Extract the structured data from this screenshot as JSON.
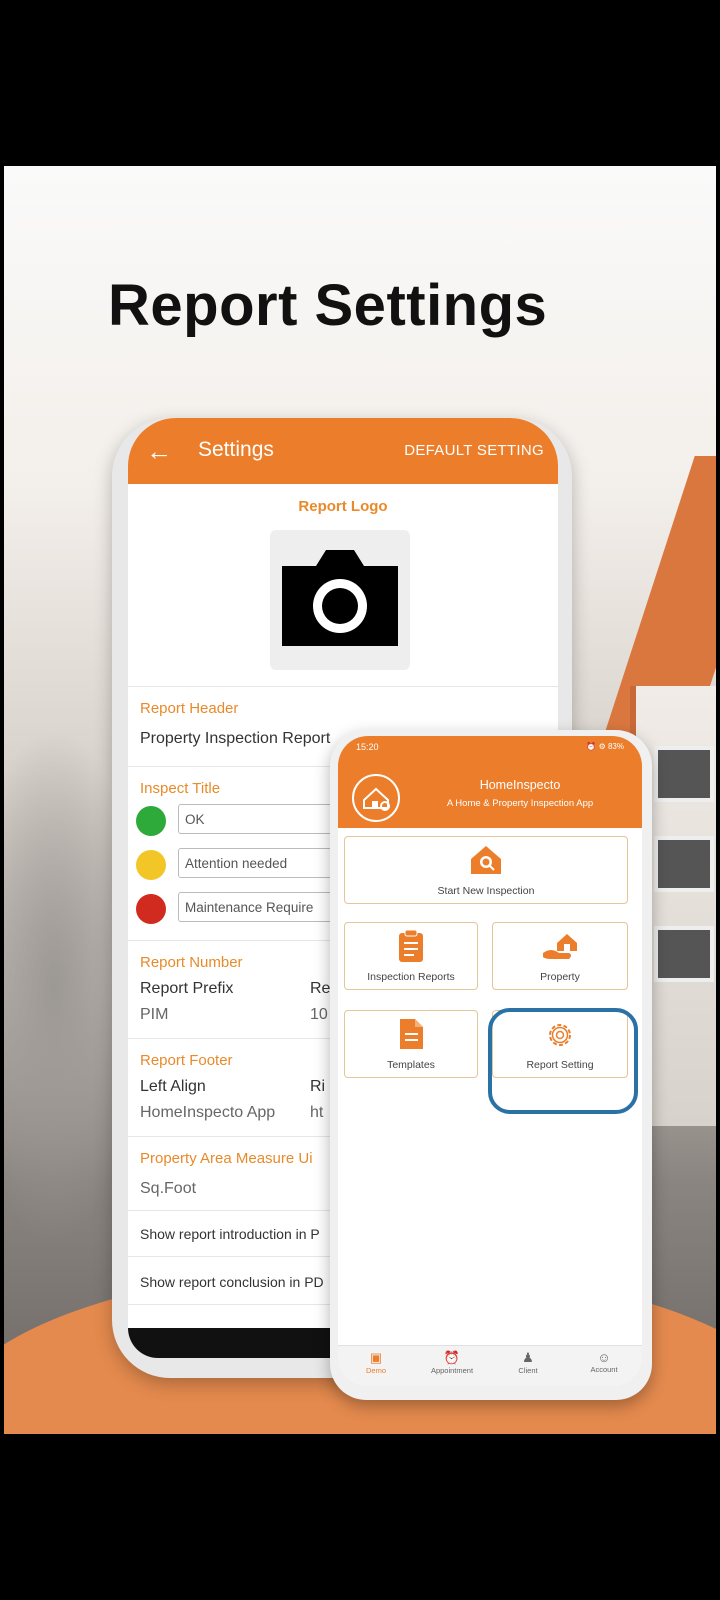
{
  "page": {
    "heading": "Report Settings",
    "colors": {
      "accent": "#ec7e2b",
      "highlight_ring": "#2a72a6",
      "ok": "#2eaa3a",
      "attention": "#f2c626",
      "maintenance": "#d12a1e"
    }
  },
  "settings_screen": {
    "back_icon": "arrow-left-icon",
    "title": "Settings",
    "default_setting": "DEFAULT SETTING",
    "report_logo_label": "Report Logo",
    "camera_icon": "camera-icon",
    "report_header_label": "Report Header",
    "report_header_value": "Property Inspection Report",
    "inspect_title_label": "Inspect Title",
    "inspect_titles": [
      "OK",
      "Attention needed",
      "Maintenance Require"
    ],
    "report_number_label": "Report Number",
    "report_prefix_label": "Report Prefix",
    "report_prefix_value": "PIM",
    "report_number_col2_label": "Re",
    "report_number_col2_value": "10",
    "report_footer_label": "Report Footer",
    "left_align_label": "Left Align",
    "left_align_value": "HomeInspecto App",
    "right_col_label": "Ri",
    "right_col_value": "ht",
    "area_measure_label": "Property Area Measure Ui",
    "area_measure_value": "Sq.Foot",
    "intro_toggle_label": "Show report introduction in P",
    "conclusion_toggle_label": "Show report conclusion in PD",
    "nav_menu_icon": "≡"
  },
  "home_screen": {
    "status_time": "15:20",
    "status_right": "⏰ ⚙ 83%",
    "app_name": "HomeInspecto",
    "tagline": "A Home & Property Inspection App",
    "tiles": {
      "start": "Start New Inspection",
      "reports": "Inspection Reports",
      "property": "Property",
      "templates": "Templates",
      "report_setting": "Report Setting"
    },
    "bottom_nav": {
      "demo": "Demo",
      "appointment": "Appointment",
      "client": "Client",
      "account": "Account"
    }
  }
}
